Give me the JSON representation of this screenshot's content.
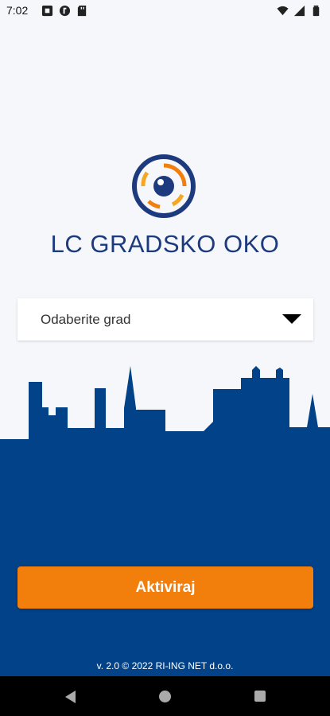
{
  "status_bar": {
    "time": "7:02",
    "left_icons": [
      "notification-square-icon",
      "download-circle-icon",
      "sd-card-icon"
    ],
    "right_icons": [
      "wifi-icon",
      "signal-icon",
      "battery-icon"
    ]
  },
  "app": {
    "title": "LC GRADSKO OKO",
    "logo_icon": "eye-logo-icon"
  },
  "city_select": {
    "placeholder": "Odaberite grad"
  },
  "activate_button": {
    "label": "Aktiviraj"
  },
  "footer": {
    "text": "v. 2.0 © 2022 RI-ING NET d.o.o."
  },
  "colors": {
    "brand_blue": "#024289",
    "title_blue": "#1c3a7d",
    "accent_orange": "#f27f0c",
    "background": "#f5f7fa"
  },
  "nav_bar": {
    "icons": [
      "back-icon",
      "home-icon",
      "recents-icon"
    ]
  }
}
